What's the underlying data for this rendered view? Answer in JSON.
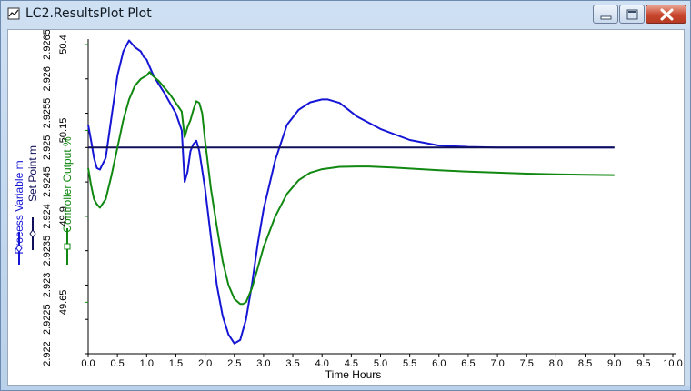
{
  "window": {
    "title": "LC2.ResultsPlot Plot",
    "controls": [
      "minimize",
      "maximize",
      "close"
    ],
    "colors": {
      "frame": "#c4d7ec",
      "close": "#c8462d"
    }
  },
  "chart_data": {
    "type": "line",
    "xlabel": "Time Hours",
    "xlim": [
      0,
      10
    ],
    "x_ticks": [
      "0.0",
      "0.5",
      "1.0",
      "1.5",
      "2.0",
      "2.5",
      "3.0",
      "3.5",
      "4.0",
      "4.5",
      "5.0",
      "5.5",
      "6.0",
      "6.5",
      "7.0",
      "7.5",
      "8.0",
      "8.5",
      "9.0",
      "9.5",
      "10.0"
    ],
    "axes": [
      {
        "label": "Process Variable m",
        "color": "#1515d6",
        "marker": "diamond"
      },
      {
        "label": "Set Point m",
        "color": "#10105a",
        "marker": "diamond",
        "ylim": [
          2.922,
          2.9265
        ],
        "ticks": [
          "2.922",
          "2.9225",
          "2.923",
          "2.9235",
          "2.924",
          "2.9245",
          "2.925",
          "2.9255",
          "2.926",
          "2.9265"
        ]
      },
      {
        "label": "Controller Output %",
        "color": "#118811",
        "marker": "square",
        "ylim": [
          49.5,
          50.4
        ],
        "ticks": [
          "49.65",
          "49.9",
          "50.15",
          "50.4"
        ]
      }
    ],
    "series": [
      {
        "name": "Process Variable m",
        "axis": "left",
        "color": "#1515d6",
        "x": [
          0,
          0.05,
          0.1,
          0.15,
          0.2,
          0.3,
          0.4,
          0.5,
          0.6,
          0.7,
          0.8,
          0.9,
          0.95,
          1.0,
          1.05,
          1.1,
          1.2,
          1.3,
          1.4,
          1.5,
          1.6,
          1.65,
          1.7,
          1.75,
          1.8,
          1.85,
          1.9,
          2.0,
          2.1,
          2.2,
          2.3,
          2.4,
          2.5,
          2.6,
          2.7,
          2.8,
          2.9,
          3.0,
          3.2,
          3.4,
          3.6,
          3.8,
          4.0,
          4.1,
          4.3,
          4.6,
          5.0,
          5.5,
          6.0,
          6.5,
          7.0,
          8.0,
          9.0
        ],
        "y": [
          2.92533,
          2.9251,
          2.92485,
          2.9247,
          2.92468,
          2.92485,
          2.92545,
          2.92605,
          2.9264,
          2.92656,
          2.92646,
          2.9264,
          2.92632,
          2.92628,
          2.92618,
          2.92608,
          2.92593,
          2.9258,
          2.92565,
          2.9255,
          2.92525,
          2.9245,
          2.92465,
          2.92495,
          2.92505,
          2.9251,
          2.92495,
          2.9244,
          2.9237,
          2.923,
          2.92255,
          2.92228,
          2.92215,
          2.9222,
          2.9225,
          2.923,
          2.9236,
          2.9241,
          2.92482,
          2.92533,
          2.92555,
          2.92566,
          2.9257,
          2.9257,
          2.92565,
          2.92545,
          2.92527,
          2.92511,
          2.92503,
          2.92501,
          2.925,
          2.925,
          2.925
        ]
      },
      {
        "name": "Set Point m",
        "axis": "left",
        "color": "#10105a",
        "x": [
          0,
          9.0
        ],
        "y": [
          2.925,
          2.925
        ]
      },
      {
        "name": "Controller Output %",
        "axis": "right",
        "color": "#118811",
        "x": [
          0,
          0.05,
          0.1,
          0.15,
          0.2,
          0.3,
          0.4,
          0.5,
          0.6,
          0.7,
          0.8,
          0.9,
          1.0,
          1.05,
          1.1,
          1.2,
          1.3,
          1.4,
          1.5,
          1.6,
          1.65,
          1.7,
          1.75,
          1.8,
          1.85,
          1.9,
          1.95,
          2.0,
          2.1,
          2.2,
          2.3,
          2.4,
          2.5,
          2.6,
          2.65,
          2.7,
          2.8,
          2.9,
          3.0,
          3.2,
          3.4,
          3.6,
          3.8,
          4.0,
          4.3,
          4.6,
          4.8,
          5.2,
          5.6,
          6.0,
          6.5,
          7.0,
          7.5,
          8.0,
          8.5,
          9.0
        ],
        "y": [
          50.04,
          49.99,
          49.95,
          49.935,
          49.925,
          49.95,
          50.02,
          50.1,
          50.18,
          50.24,
          50.28,
          50.3,
          50.31,
          50.32,
          50.31,
          50.295,
          50.275,
          50.255,
          50.23,
          50.205,
          50.13,
          50.16,
          50.18,
          50.21,
          50.235,
          50.23,
          50.2,
          50.12,
          49.98,
          49.87,
          49.77,
          49.7,
          49.66,
          49.645,
          49.645,
          49.65,
          49.69,
          49.75,
          49.81,
          49.9,
          49.965,
          50.005,
          50.027,
          50.037,
          50.044,
          50.045,
          50.045,
          50.042,
          50.038,
          50.034,
          50.03,
          50.027,
          50.024,
          50.022,
          50.021,
          50.02
        ]
      }
    ]
  }
}
